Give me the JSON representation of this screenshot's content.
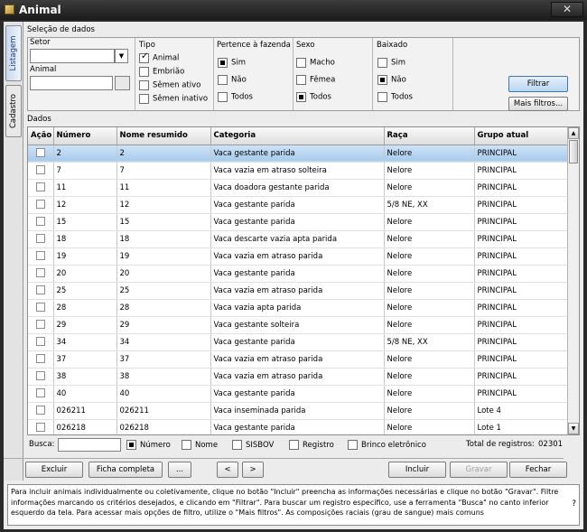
{
  "window": {
    "title": "Animal",
    "close_glyph": "✕"
  },
  "vertical_tabs": [
    "Listagem",
    "Cadastro"
  ],
  "selection": {
    "label": "Seleção de dados",
    "setor_label": "Setor",
    "setor_value": "",
    "animal_label": "Animal",
    "animal_value": "",
    "tipo": {
      "label": "Tipo",
      "options": [
        {
          "label": "Animal",
          "checked": true
        },
        {
          "label": "Embrião",
          "checked": false
        },
        {
          "label": "Sêmen ativo",
          "checked": false
        },
        {
          "label": "Sêmen inativo",
          "checked": false
        }
      ]
    },
    "pertence": {
      "label": "Pertence à fazenda",
      "options": [
        {
          "label": "Sim",
          "checked": true
        },
        {
          "label": "Não",
          "checked": false
        },
        {
          "label": "Todos",
          "checked": false
        }
      ]
    },
    "sexo": {
      "label": "Sexo",
      "options": [
        {
          "label": "Macho",
          "checked": false
        },
        {
          "label": "Fêmea",
          "checked": false
        },
        {
          "label": "Todos",
          "checked": true
        }
      ]
    },
    "baixado": {
      "label": "Baixado",
      "options": [
        {
          "label": "Sim",
          "checked": false
        },
        {
          "label": "Não",
          "checked": true
        },
        {
          "label": "Todos",
          "checked": false
        }
      ]
    },
    "filtrar_label": "Filtrar",
    "mais_filtros_label": "Mais filtros..."
  },
  "dados_label": "Dados",
  "table": {
    "columns": [
      "Ação",
      "Número",
      "Nome resumido",
      "Categoria",
      "Raça",
      "Grupo atual"
    ],
    "rows": [
      [
        "2",
        "2",
        "Vaca gestante parida",
        "Nelore",
        "PRINCIPAL"
      ],
      [
        "7",
        "7",
        "Vaca vazia em atraso solteira",
        "Nelore",
        "PRINCIPAL"
      ],
      [
        "11",
        "11",
        "Vaca doadora gestante parida",
        "Nelore",
        "PRINCIPAL"
      ],
      [
        "12",
        "12",
        "Vaca gestante parida",
        "5/8 NE, XX",
        "PRINCIPAL"
      ],
      [
        "15",
        "15",
        "Vaca gestante parida",
        "Nelore",
        "PRINCIPAL"
      ],
      [
        "18",
        "18",
        "Vaca descarte vazia apta parida",
        "Nelore",
        "PRINCIPAL"
      ],
      [
        "19",
        "19",
        "Vaca vazia em atraso parida",
        "Nelore",
        "PRINCIPAL"
      ],
      [
        "20",
        "20",
        "Vaca gestante parida",
        "Nelore",
        "PRINCIPAL"
      ],
      [
        "25",
        "25",
        "Vaca vazia em atraso parida",
        "Nelore",
        "PRINCIPAL"
      ],
      [
        "28",
        "28",
        "Vaca vazia apta parida",
        "Nelore",
        "PRINCIPAL"
      ],
      [
        "29",
        "29",
        "Vaca gestante solteira",
        "Nelore",
        "PRINCIPAL"
      ],
      [
        "34",
        "34",
        "Vaca gestante parida",
        "5/8 NE, XX",
        "PRINCIPAL"
      ],
      [
        "37",
        "37",
        "Vaca vazia em atraso parida",
        "Nelore",
        "PRINCIPAL"
      ],
      [
        "38",
        "38",
        "Vaca vazia em atraso parida",
        "Nelore",
        "PRINCIPAL"
      ],
      [
        "40",
        "40",
        "Vaca gestante parida",
        "Nelore",
        "PRINCIPAL"
      ],
      [
        "026211",
        "026211",
        "Vaca inseminada parida",
        "Nelore",
        "Lote 4"
      ],
      [
        "026218",
        "026218",
        "Vaca gestante parida",
        "Nelore",
        "Lote 1"
      ]
    ]
  },
  "search": {
    "label": "Busca:",
    "value": "",
    "options": [
      {
        "label": "Número",
        "checked": true
      },
      {
        "label": "Nome",
        "checked": false
      },
      {
        "label": "SISBOV",
        "checked": false
      },
      {
        "label": "Registro",
        "checked": false
      },
      {
        "label": "Brinco eletrônico",
        "checked": false
      }
    ],
    "total_label": "Total de registros:",
    "total_value": "02301"
  },
  "buttons": {
    "excluir": "Excluir",
    "ficha": "Ficha completa",
    "more": "...",
    "prev": "<",
    "next": ">",
    "incluir": "Incluir",
    "gravar": "Gravar",
    "fechar": "Fechar"
  },
  "help": {
    "text": "Para incluir animais individualmente ou coletivamente, clique no botão \"Incluir\" preencha as informações necessárias e clique no botão \"Gravar\". Filtre informações marcando os critérios desejados, e clicando em \"Filtrar\". Para buscar um registro específico, use a ferramenta \"Busca\" no canto inferior esquerdo da tela. Para acessar mais opções de filtro, utilize o \"Mais filtros\". As composições raciais (grau de sangue) mais comuns",
    "question": "?"
  }
}
